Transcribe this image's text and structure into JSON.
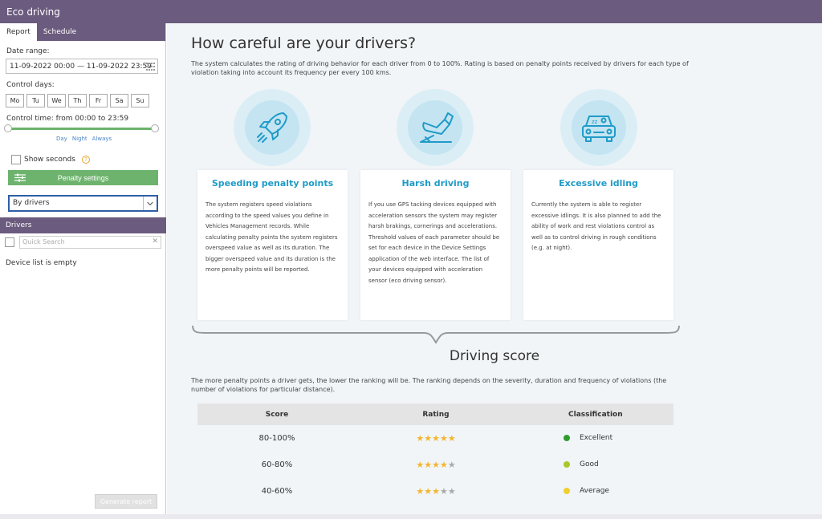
{
  "app": {
    "title": "Eco driving"
  },
  "sidebar": {
    "tabs": [
      "Report",
      "Schedule"
    ],
    "date_range_label": "Date range:",
    "date_range_value": "11-09-2022 00:00 — 11-09-2022 23:59",
    "control_days_label": "Control days:",
    "days": [
      "Mo",
      "Tu",
      "We",
      "Th",
      "Fr",
      "Sa",
      "Su"
    ],
    "control_time_label": "Control time: from 00:00 to 23:59",
    "time_presets": [
      "Day",
      "Night",
      "Always"
    ],
    "show_seconds_label": "Show seconds",
    "penalty_settings_label": "Penalty settings",
    "group_by_value": "By drivers",
    "drivers_header": "Drivers",
    "quick_search_placeholder": "Quick Search",
    "empty_message": "Device list is empty",
    "generate_label": "Generate report"
  },
  "main": {
    "title": "How careful are your drivers?",
    "description": "The system calculates the rating of driving behavior for each driver from 0 to 100%. Rating is based on penalty points received by drivers for each type of violation taking into account its frequency per every 100 kms.",
    "cards": [
      {
        "icon": "rocket-icon",
        "title": "Speeding penalty points",
        "text": "The system registers speed violations according to the speed values you define in Vehicles Management records. While calculating penalty points the system registers overspeed value as well as its duration. The bigger overspeed value and its duration is the more penalty points will be reported."
      },
      {
        "icon": "pedal-icon",
        "title": "Harsh driving",
        "text": "If you use GPS tacking devices equipped with acceleration sensors the system may register harsh brakings, cornerings and accelerations. Threshold values of each parameter should be set for each device in the Device Settings application of the web interface. The list of your devices equipped with acceleration sensor (eco driving sensor)."
      },
      {
        "icon": "idling-car-icon",
        "title": "Excessive idling",
        "text": "Currently the system is able to register excessive idlings. It is also planned to add the ability of work and rest violations control as well as to control driving in rough conditions (e.g. at night)."
      }
    ],
    "score_title": "Driving score",
    "score_description": "The more penalty points a driver gets, the lower the ranking will be. The ranking depends on the severity, duration and frequency of violations (the number of violations for particular distance).",
    "table": {
      "headers": [
        "Score",
        "Rating",
        "Classification"
      ],
      "rows": [
        {
          "score": "80-100%",
          "stars": 5,
          "classification": "Excellent",
          "color": "#2e9d2e"
        },
        {
          "score": "60-80%",
          "stars": 4,
          "classification": "Good",
          "color": "#a8c82a"
        },
        {
          "score": "40-60%",
          "stars": 3,
          "classification": "Average",
          "color": "#f0cf2f"
        }
      ]
    }
  }
}
